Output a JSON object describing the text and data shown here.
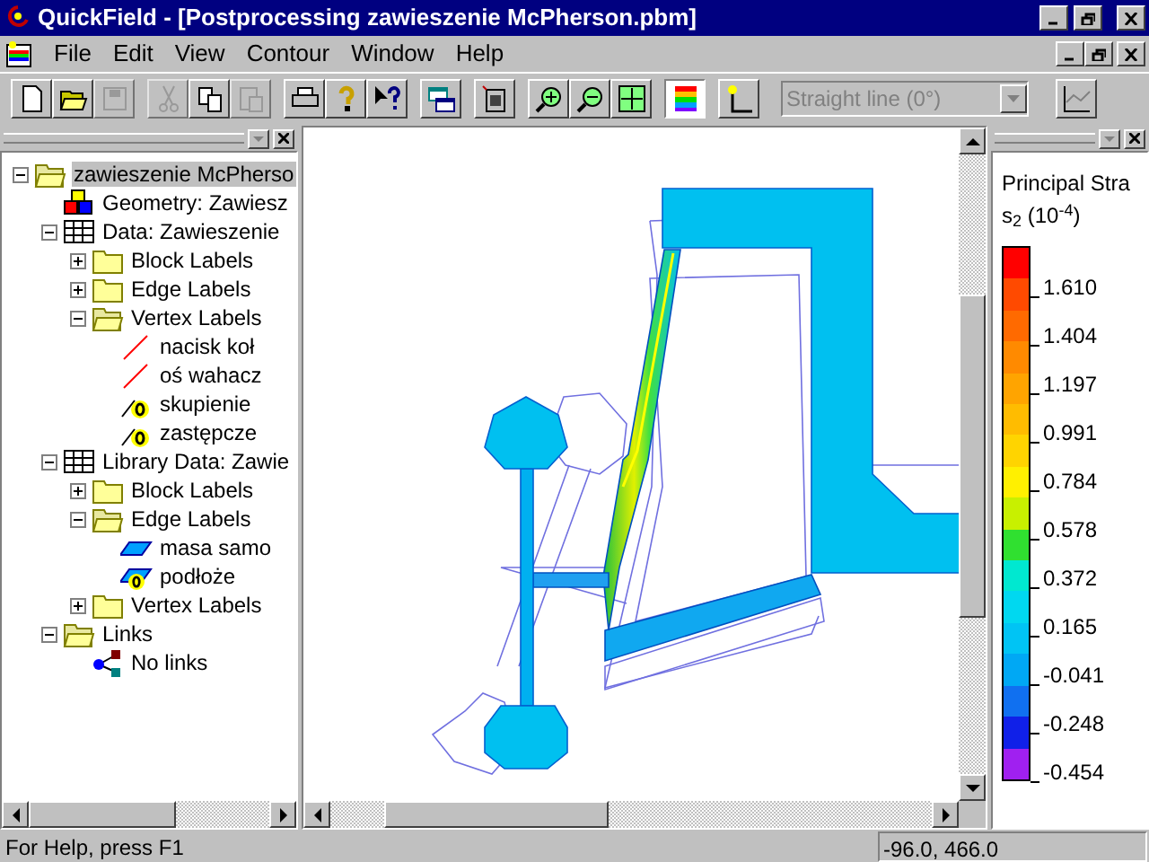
{
  "window": {
    "title": "QuickField - [Postprocessing zawieszenie McPherson.pbm]"
  },
  "menu": [
    "File",
    "Edit",
    "View",
    "Contour",
    "Window",
    "Help"
  ],
  "toolbar": [
    [
      {
        "kind": "new",
        "disabled": false
      },
      {
        "kind": "open",
        "disabled": false
      },
      {
        "kind": "save",
        "disabled": true
      }
    ],
    [
      {
        "kind": "cut",
        "disabled": true
      },
      {
        "kind": "copy",
        "disabled": false
      },
      {
        "kind": "paste",
        "disabled": true
      }
    ],
    [
      {
        "kind": "print",
        "disabled": false
      },
      {
        "kind": "help",
        "disabled": false
      },
      {
        "kind": "context-help",
        "disabled": false
      }
    ],
    [
      {
        "kind": "windows",
        "disabled": false
      }
    ],
    [
      {
        "kind": "copy-picture",
        "disabled": false
      }
    ],
    [
      {
        "kind": "zoom-in",
        "disabled": false
      },
      {
        "kind": "zoom-out",
        "disabled": false
      },
      {
        "kind": "zoom-fit",
        "disabled": false
      }
    ],
    [
      {
        "kind": "color-map",
        "disabled": false,
        "pressed": true
      }
    ],
    [
      {
        "kind": "add-point",
        "disabled": false,
        "pressed": false
      }
    ]
  ],
  "line_combo": {
    "value": "Straight line (0°)",
    "disabled": true
  },
  "tree": [
    {
      "label": "zawieszenie McPherso",
      "kind": "folder-open",
      "selected": true,
      "expanded": true,
      "children": [
        {
          "label": "Geometry: Zawiesz",
          "kind": "geometry"
        },
        {
          "label": "Data: Zawieszenie",
          "kind": "table",
          "expanded": true,
          "children": [
            {
              "label": "Block Labels",
              "kind": "folder",
              "expanded": false
            },
            {
              "label": "Edge Labels",
              "kind": "folder",
              "expanded": false
            },
            {
              "label": "Vertex Labels",
              "kind": "folder-open",
              "expanded": true,
              "children": [
                {
                  "label": "nacisk koł",
                  "kind": "line"
                },
                {
                  "label": "oś wahacz",
                  "kind": "line"
                },
                {
                  "label": "skupienie",
                  "kind": "vertex-zero"
                },
                {
                  "label": "zastępcze",
                  "kind": "vertex-zero"
                }
              ]
            }
          ]
        },
        {
          "label": "Library Data: Zawie",
          "kind": "table",
          "expanded": true,
          "children": [
            {
              "label": "Block Labels",
              "kind": "folder",
              "expanded": false
            },
            {
              "label": "Edge Labels",
              "kind": "folder-open",
              "expanded": true,
              "children": [
                {
                  "label": "masa samo",
                  "kind": "edge"
                },
                {
                  "label": "podłoże",
                  "kind": "edge-zero"
                }
              ]
            },
            {
              "label": "Vertex Labels",
              "kind": "folder",
              "expanded": false
            }
          ]
        },
        {
          "label": "Links",
          "kind": "folder-open",
          "expanded": true,
          "children": [
            {
              "label": "No links",
              "kind": "links"
            }
          ]
        }
      ]
    }
  ],
  "legend": {
    "title": "Principal Stra",
    "unit": "s$_{2}$ (10$^{-4}$)",
    "bands": [
      {
        "color": "#ff0000"
      },
      {
        "color": "#ff4a00"
      },
      {
        "color": "#ff6a00"
      },
      {
        "color": "#ff8a00"
      },
      {
        "color": "#ffa400"
      },
      {
        "color": "#ffbc00"
      },
      {
        "color": "#ffd400"
      },
      {
        "color": "#fff000"
      },
      {
        "color": "#c8f000"
      },
      {
        "color": "#30e030"
      },
      {
        "color": "#00e8d0"
      },
      {
        "color": "#00d8f0"
      },
      {
        "color": "#00c4f4"
      },
      {
        "color": "#00a8f4"
      },
      {
        "color": "#1070f0"
      },
      {
        "color": "#1020e8"
      },
      {
        "color": "#a020f0"
      }
    ],
    "ticks": [
      "1.610",
      "1.404",
      "1.197",
      "0.991",
      "0.784",
      "0.578",
      "0.372",
      "0.165",
      "-0.041",
      "-0.248",
      "-0.454"
    ]
  },
  "status_bar": {
    "help": "For Help, press F1",
    "coordinates": "-96.0, 466.0"
  }
}
